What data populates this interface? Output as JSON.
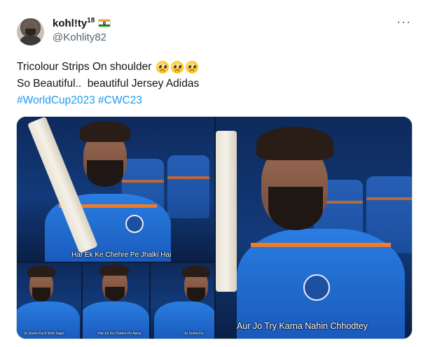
{
  "author": {
    "display_name": "kohl!ty",
    "superscript": "18",
    "flag_icon": "india-flag-icon",
    "handle": "@Kohlity82",
    "avatar_icon": "profile-avatar"
  },
  "menu": {
    "more_label": "···"
  },
  "tweet": {
    "line1": "Tricolour Strips On shoulder",
    "line1_emojis": [
      "pleading-face-emoji",
      "pleading-face-emoji",
      "pleading-face-emoji"
    ],
    "line2": "So Beautiful..  beautiful Jersey Adidas",
    "hashtags": [
      "#WorldCup2023",
      "#CWC23"
    ]
  },
  "media": {
    "captions": {
      "main_left": "Har Ek Ke Chehre Pe Jhalki Hai",
      "right": "Aur Jo Try Karna Nahin Chhodtey",
      "thumb1": "Jo Some Kuch Woh Sapn",
      "thumb2": "Har Ek Ke Chehre Pe Apna",
      "thumb3": "Jo Some Ko"
    }
  },
  "colors": {
    "link": "#1d9bf0",
    "secondary_text": "#536471",
    "jersey_blue": "#1e54a8",
    "tricolour_orange": "#f27b26"
  }
}
